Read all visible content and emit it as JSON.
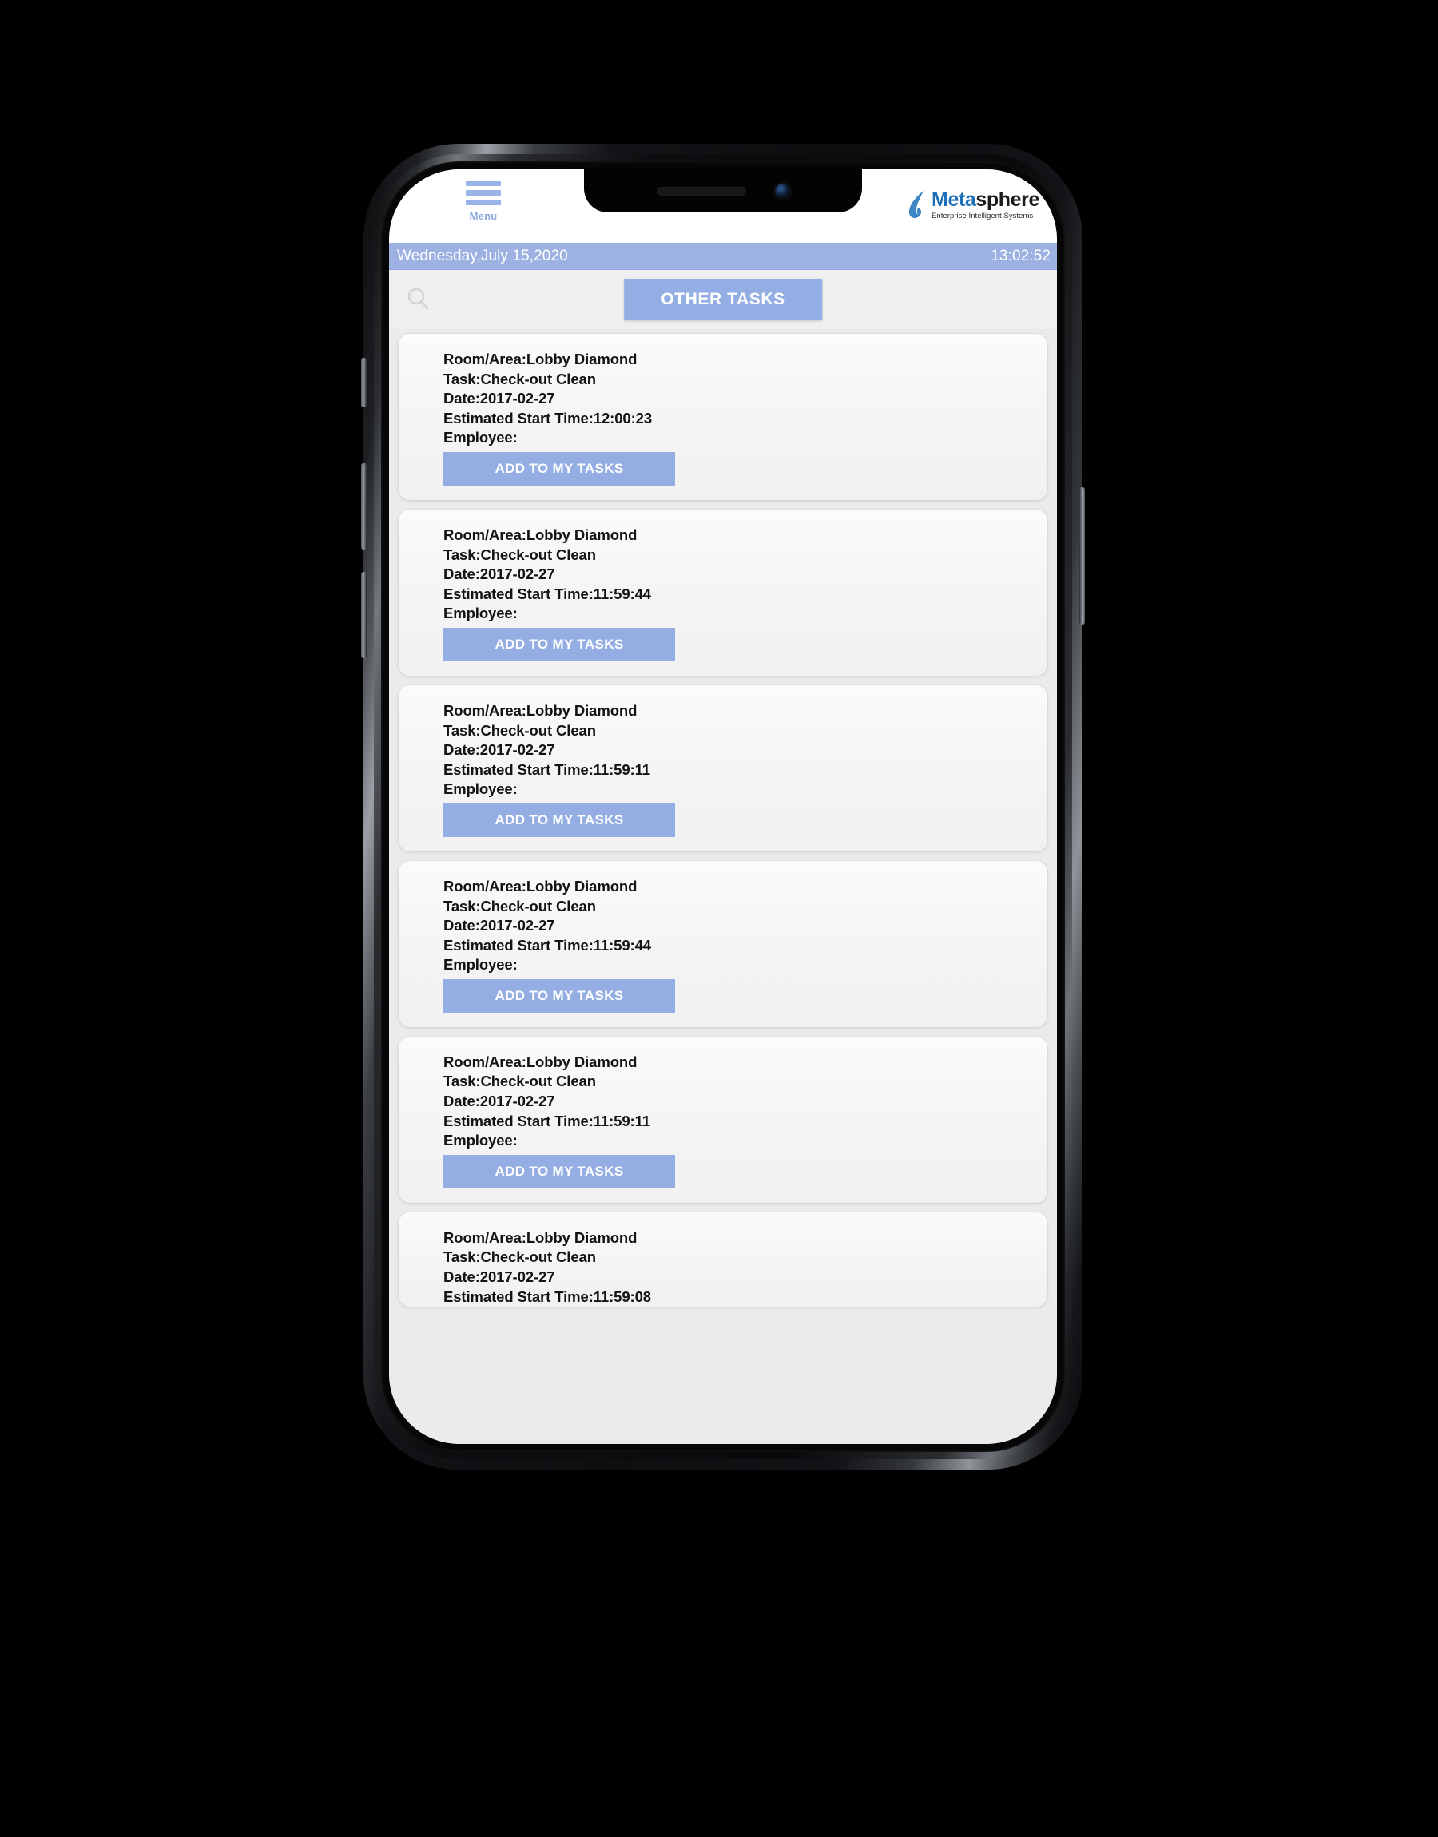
{
  "device": {
    "frame": "iphone-x",
    "background_color": "#000000",
    "bezel_color": "#060607",
    "screen_background": "#ededed"
  },
  "colors": {
    "accent_blue": "#93aee4",
    "date_bar": "#9db2e2",
    "brand_blue": "#1d6fb8",
    "card_background": "#f6f6f6",
    "text_dark": "#131313"
  },
  "header": {
    "menu_icon": "hamburger-icon",
    "menu_label": "Menu",
    "brand": {
      "name_part1": "Meta",
      "name_part2": "sphere",
      "tagline": "Enterprise Intelligent Systems",
      "mark": "leaf-swoosh-icon"
    }
  },
  "status_bar": {
    "date": "Wednesday,July 15,2020",
    "time": "13:02:52"
  },
  "toolbar": {
    "search_icon": "search-icon",
    "search_placeholder": "",
    "other_tasks_label": "OTHER TASKS"
  },
  "labels": {
    "room_area": "Room/Area:",
    "task": "Task:",
    "date": "Date:",
    "estimated_start_time": "Estimated Start Time:",
    "employee": "Employee:",
    "add_to_my_tasks": "ADD TO MY TASKS"
  },
  "tasks": [
    {
      "room_area": "Room/Area:Lobby Diamond",
      "task": "Task:Check-out Clean",
      "date": "Date:2017-02-27",
      "start_time": "Estimated Start Time:12:00:23",
      "employee": "Employee:",
      "button": "ADD TO MY TASKS",
      "indent": 56,
      "truncated": false
    },
    {
      "room_area": "Room/Area:Lobby Diamond",
      "task": "Task:Check-out Clean",
      "date": "Date:2017-02-27",
      "start_time": "Estimated Start Time:11:59:44",
      "employee": "Employee:",
      "button": "ADD TO MY TASKS",
      "indent": 56,
      "truncated": false
    },
    {
      "room_area": "Room/Area:Lobby Diamond",
      "task": "Task:Check-out Clean",
      "date": "Date:2017-02-27",
      "start_time": "Estimated Start Time:11:59:11",
      "employee": "Employee:",
      "button": "ADD TO MY TASKS",
      "indent": 56,
      "truncated": false
    },
    {
      "room_area": "Room/Area:Lobby Diamond",
      "task": "Task:Check-out Clean",
      "date": "Date:2017-02-27",
      "start_time": "Estimated Start Time:11:59:44",
      "employee": "Employee:",
      "button": "ADD TO MY TASKS",
      "indent": 56,
      "truncated": false
    },
    {
      "room_area": "Room/Area:Lobby Diamond",
      "task": "Task:Check-out Clean",
      "date": "Date:2017-02-27",
      "start_time": "Estimated Start Time:11:59:11",
      "employee": "Employee:",
      "button": "ADD TO MY TASKS",
      "indent": 56,
      "truncated": false
    },
    {
      "room_area": "Room/Area:Lobby Diamond",
      "task": "Task:Check-out Clean",
      "date": "Date:2017-02-27",
      "start_time": "Estimated Start Time:11:59:08",
      "employee": "",
      "button": "",
      "indent": 56,
      "truncated": true
    }
  ]
}
